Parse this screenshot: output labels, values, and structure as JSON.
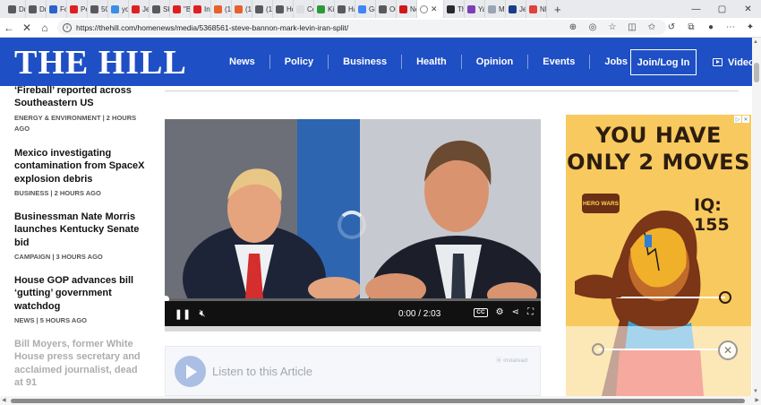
{
  "browser": {
    "tabs": [
      {
        "label": "Dr",
        "color": "#5a5a5a"
      },
      {
        "label": "Dr.",
        "color": "#5a5a5a"
      },
      {
        "label": "Fo",
        "color": "#2b63c9"
      },
      {
        "label": "Pe",
        "color": "#e02020"
      },
      {
        "label": "50",
        "color": "#5a5a5a"
      },
      {
        "label": "yo",
        "color": "#3a8ee6"
      },
      {
        "label": "Jer",
        "color": "#e02020"
      },
      {
        "label": "Sk",
        "color": "#5a5a5a"
      },
      {
        "label": "\"Bl",
        "color": "#e02020"
      },
      {
        "label": "In",
        "color": "#e02020"
      },
      {
        "label": "(10",
        "color": "#e8602c"
      },
      {
        "label": "(10",
        "color": "#e8602c"
      },
      {
        "label": "(10",
        "color": "#5a5a5a"
      },
      {
        "label": "Ho",
        "color": "#5a5a5a"
      },
      {
        "label": "Co",
        "color": "#dddddd"
      },
      {
        "label": "Kir",
        "color": "#2d9a3a"
      },
      {
        "label": "Ha",
        "color": "#5a5a5a"
      },
      {
        "label": "Gr",
        "color": "#4285f4"
      },
      {
        "label": "Ou",
        "color": "#5a5a5a"
      },
      {
        "label": "Ne",
        "color": "#d01818"
      }
    ],
    "active_tab_label": "",
    "tabs_after": [
      {
        "label": "Th",
        "color": "#2a2a2a"
      },
      {
        "label": "Ya",
        "color": "#7b3fb6"
      },
      {
        "label": "M",
        "color": "#9aa4b2"
      },
      {
        "label": "Jer",
        "color": "#1a3d8a"
      },
      {
        "label": "NF",
        "color": "#e0413a"
      }
    ],
    "new_tab": "+",
    "window_controls": {
      "minimize": "—",
      "maximize": "▢",
      "close": "✕"
    },
    "url": "https://thehill.com/homenews/media/5368561-steve-bannon-mark-levin-iran-split/"
  },
  "site": {
    "logo": "THE HILL",
    "nav": [
      "News",
      "Policy",
      "Business",
      "Health",
      "Opinion",
      "Events",
      "Jobs"
    ],
    "login_label": "Join/Log In",
    "video_label": "Video"
  },
  "sidebar": {
    "articles": [
      {
        "title": "‘Fireball’ reported across Southeastern US",
        "meta": "ENERGY & ENVIRONMENT | 2 HOURS AGO"
      },
      {
        "title": "Mexico investigating contamination from SpaceX explosion debris",
        "meta": "BUSINESS | 2 HOURS AGO"
      },
      {
        "title": "Businessman Nate Morris launches Kentucky Senate bid",
        "meta": "CAMPAIGN | 3 HOURS AGO"
      },
      {
        "title": "House GOP advances bill ‘gutting’ government watchdog",
        "meta": "NEWS | 5 HOURS AGO"
      },
      {
        "title": "Bill Moyers, former White House press secretary and acclaimed journalist, dead at 91",
        "meta": ""
      }
    ]
  },
  "video": {
    "current_time": "0:00",
    "duration": "/ 2:03",
    "cc_label": "CC",
    "progress": 0
  },
  "listen": {
    "label": "Listen to this Article",
    "powered": "⦿ instaread"
  },
  "ad": {
    "headline_line1": "YOU HAVE",
    "headline_line2": "ONLY 2 MOVES",
    "iq": "IQ: 155",
    "brand": "HERO WARS",
    "close": "✕"
  }
}
